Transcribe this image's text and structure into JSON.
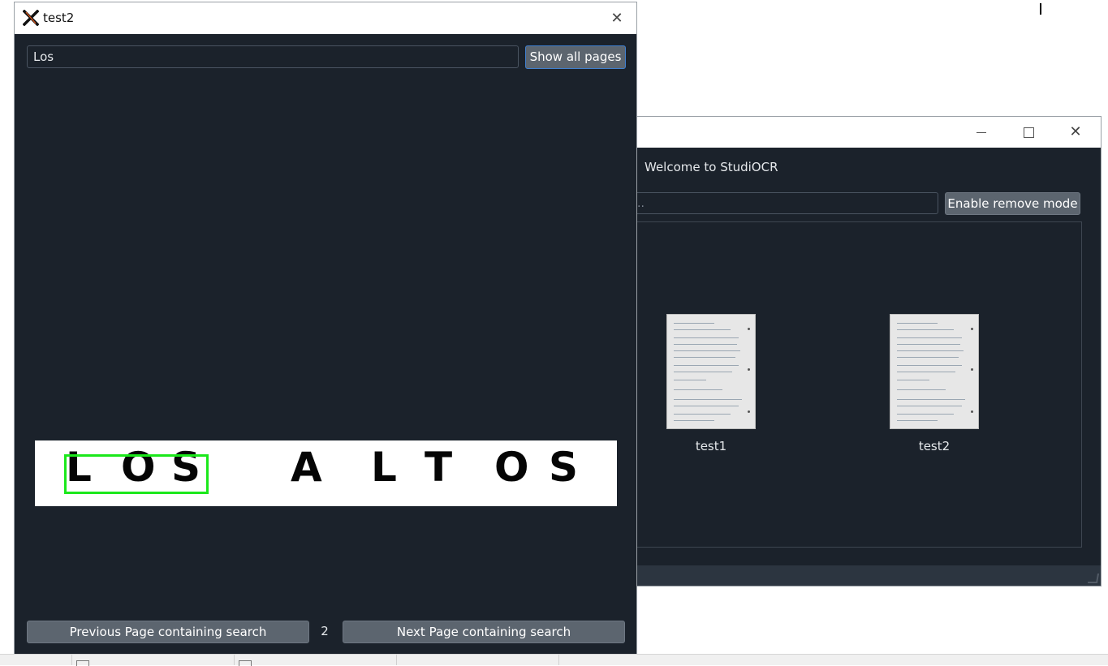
{
  "main_window": {
    "welcome_text": "Welcome to StudiOCR",
    "search_placeholder_visible": "..",
    "remove_button_label": "Enable remove mode",
    "documents": [
      {
        "name": "test1"
      },
      {
        "name": "test2"
      }
    ],
    "controls": {
      "minimize_icon": "minimize-icon",
      "maximize_icon": "maximize-icon",
      "close_icon": "close-icon"
    }
  },
  "viewer_window": {
    "title": "test2",
    "app_icon": "x-app-icon",
    "search_value": "Los",
    "show_all_label": "Show all pages",
    "page_image_text": [
      "L",
      "O",
      "S",
      "A",
      "L",
      "T",
      "O",
      "S"
    ],
    "prev_button_label": "Previous Page containing search",
    "page_number": "2",
    "next_button_label": "Next Page containing search",
    "colors": {
      "highlight": "#1be81b",
      "background": "#1b222b",
      "button": "#5c656f",
      "focus_border": "#3f7fcf"
    }
  }
}
